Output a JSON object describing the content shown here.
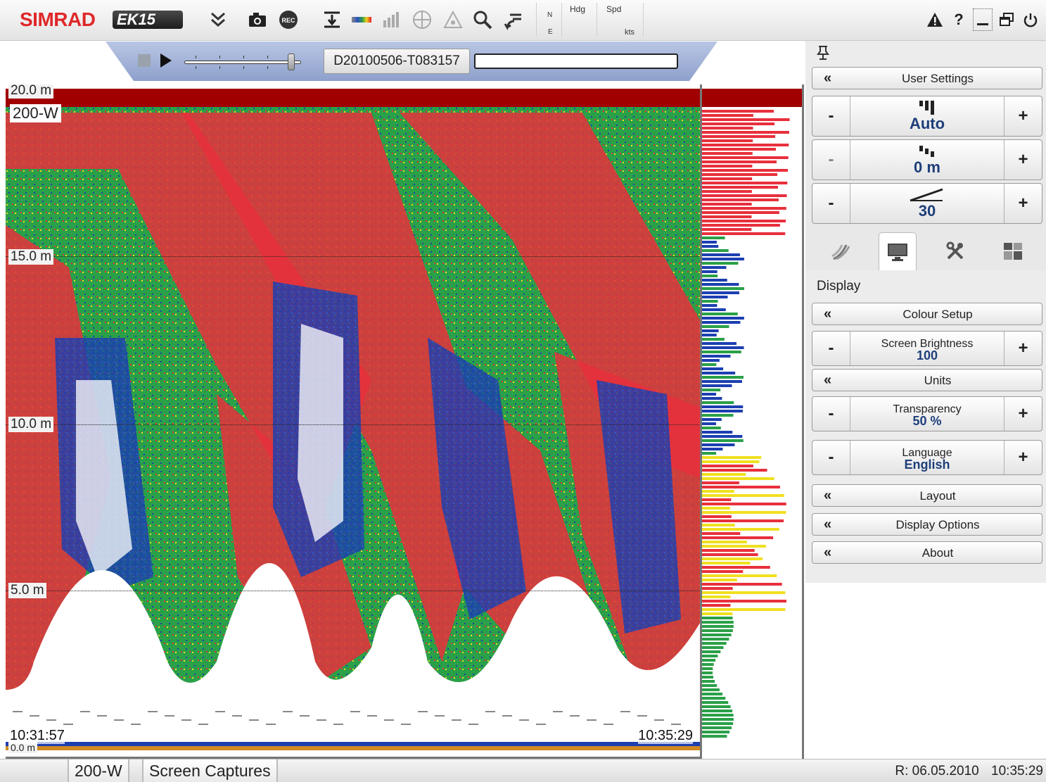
{
  "app": {
    "brand": "SIMRAD",
    "model": "EK15"
  },
  "toolbar": {
    "icons": [
      "double-chevron-down-icon",
      "camera-icon",
      "record-icon",
      "depth-icon",
      "colour-scale-icon",
      "histogram-icon",
      "compass-icon",
      "triangle-icon",
      "zoom-icon",
      "back-arrow-icon"
    ],
    "record_label": "REC",
    "nav": {
      "north": "N",
      "east": "E",
      "hdg_label": "Hdg",
      "spd_label": "Spd",
      "spd_unit": "kts"
    },
    "system_icons": [
      "alarm-icon",
      "help-icon",
      "minimize-icon",
      "restore-icon",
      "power-icon"
    ]
  },
  "replay": {
    "file_name": "D20100506-T083157",
    "position": 0.94
  },
  "echogram": {
    "channel": "200-W",
    "depth_labels": [
      "20.0 m",
      "15.0 m",
      "10.0 m",
      "5.0 m",
      "0.0 m"
    ],
    "depth_values": [
      20,
      15,
      10,
      5,
      0
    ],
    "time_start": "10:31:57",
    "time_end": "10:35:29",
    "colors": {
      "strong": "#e8303c",
      "medium": "#f0e020",
      "weak_green": "#2aa048",
      "weak": "#1c3fb0",
      "surface": "#a00000"
    }
  },
  "panel": {
    "user_settings": "User Settings",
    "gain": {
      "value": "Auto"
    },
    "range_start": {
      "value": "0 m"
    },
    "range": {
      "value": "30"
    },
    "tabs": [
      "operation-tab",
      "display-tab",
      "setup-tab",
      "active-tab"
    ],
    "display_title": "Display",
    "colour_setup": "Colour Setup",
    "screen_brightness": {
      "label": "Screen Brightness",
      "value": "100"
    },
    "units": "Units",
    "transparency": {
      "label": "Transparency",
      "value": "50 %"
    },
    "language": {
      "label": "Language",
      "value": "English"
    },
    "layout": "Layout",
    "display_options": "Display Options",
    "about": "About",
    "minus": "-",
    "plus": "+",
    "chevron": "«"
  },
  "status": {
    "tab1": "200-W",
    "tab2": "Screen Captures",
    "replay_date": "R: 06.05.2010",
    "clock": "10:35:29"
  }
}
